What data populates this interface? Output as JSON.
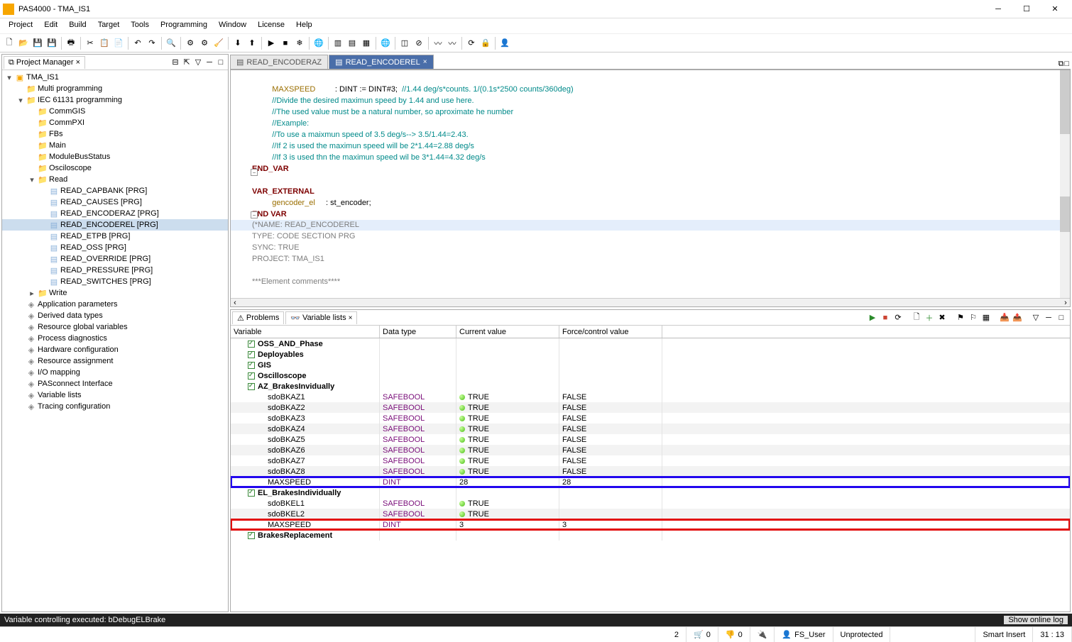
{
  "titlebar": {
    "title": "PAS4000 - TMA_IS1"
  },
  "menu": [
    "Project",
    "Edit",
    "Build",
    "Target",
    "Tools",
    "Programming",
    "Window",
    "License",
    "Help"
  ],
  "pm": {
    "title": "Project Manager",
    "tree": [
      {
        "lvl": 0,
        "exp": "-",
        "ic": "proj",
        "label": "TMA_IS1"
      },
      {
        "lvl": 1,
        "exp": " ",
        "ic": "folder",
        "label": "Multi programming"
      },
      {
        "lvl": 1,
        "exp": "-",
        "ic": "folder",
        "label": "IEC 61131 programming"
      },
      {
        "lvl": 2,
        "exp": " ",
        "ic": "folder",
        "label": "CommGIS"
      },
      {
        "lvl": 2,
        "exp": " ",
        "ic": "folder",
        "label": "CommPXI"
      },
      {
        "lvl": 2,
        "exp": " ",
        "ic": "folder",
        "label": "FBs"
      },
      {
        "lvl": 2,
        "exp": " ",
        "ic": "folder",
        "label": "Main"
      },
      {
        "lvl": 2,
        "exp": " ",
        "ic": "folder",
        "label": "ModuleBusStatus"
      },
      {
        "lvl": 2,
        "exp": " ",
        "ic": "folder",
        "label": "Osciloscope"
      },
      {
        "lvl": 2,
        "exp": "-",
        "ic": "folder",
        "label": "Read"
      },
      {
        "lvl": 3,
        "exp": " ",
        "ic": "prg",
        "label": "READ_CAPBANK [PRG]"
      },
      {
        "lvl": 3,
        "exp": " ",
        "ic": "prg",
        "label": "READ_CAUSES [PRG]"
      },
      {
        "lvl": 3,
        "exp": " ",
        "ic": "prg",
        "label": "READ_ENCODERAZ [PRG]"
      },
      {
        "lvl": 3,
        "exp": " ",
        "ic": "prg",
        "label": "READ_ENCODEREL [PRG]",
        "sel": true
      },
      {
        "lvl": 3,
        "exp": " ",
        "ic": "prg",
        "label": "READ_ETPB [PRG]"
      },
      {
        "lvl": 3,
        "exp": " ",
        "ic": "prg",
        "label": "READ_OSS [PRG]"
      },
      {
        "lvl": 3,
        "exp": " ",
        "ic": "prg",
        "label": "READ_OVERRIDE [PRG]"
      },
      {
        "lvl": 3,
        "exp": " ",
        "ic": "prg",
        "label": "READ_PRESSURE [PRG]"
      },
      {
        "lvl": 3,
        "exp": " ",
        "ic": "prg",
        "label": "READ_SWITCHES [PRG]"
      },
      {
        "lvl": 2,
        "exp": "+",
        "ic": "folder",
        "label": "Write"
      },
      {
        "lvl": 1,
        "exp": " ",
        "ic": "gear",
        "label": "Application parameters"
      },
      {
        "lvl": 1,
        "exp": " ",
        "ic": "gear",
        "label": "Derived data types"
      },
      {
        "lvl": 1,
        "exp": " ",
        "ic": "gear",
        "label": "Resource global variables"
      },
      {
        "lvl": 1,
        "exp": " ",
        "ic": "gear",
        "label": "Process diagnostics"
      },
      {
        "lvl": 1,
        "exp": " ",
        "ic": "gear",
        "label": "Hardware configuration"
      },
      {
        "lvl": 1,
        "exp": " ",
        "ic": "gear",
        "label": "Resource assignment"
      },
      {
        "lvl": 1,
        "exp": " ",
        "ic": "gear",
        "label": "I/O mapping"
      },
      {
        "lvl": 1,
        "exp": " ",
        "ic": "gear",
        "label": "PASconnect Interface"
      },
      {
        "lvl": 1,
        "exp": " ",
        "ic": "gear",
        "label": "Variable lists"
      },
      {
        "lvl": 1,
        "exp": " ",
        "ic": "gear",
        "label": "Tracing configuration"
      }
    ]
  },
  "editor_tabs": [
    {
      "label": "READ_ENCODERAZ",
      "active": false
    },
    {
      "label": "READ_ENCODEREL",
      "active": true
    }
  ],
  "code": {
    "l1a": "    MAXSPEED",
    "l1b": "         : DINT := DINT#3;  ",
    "l1c": "//1.44 deg/s*counts. 1/(0.1s*2500 counts/360deg)",
    "l2": "    //Divide the desired maximun speed by 1.44 and use here.",
    "l3": "    //The used value must be a natural number, so aproximate he number",
    "l4": "    //Example:",
    "l5": "    //To use a maixmun speed of 3.5 deg/s--> 3.5/1.44=2.43.",
    "l6": "    //If 2 is used the maximun speed will be 2*1.44=2.88 deg/s",
    "l7": "    //If 3 is used thn the maximun speed wil be 3*1.44=4.32 deg/s",
    "l8": "END_VAR",
    "l9": "",
    "l10": "VAR_EXTERNAL",
    "l11a": "    gencoder_el",
    "l11b": "     : st_encoder;",
    "l12": "END VAR",
    "l13": "",
    "l14": "(*NAME: READ_ENCODEREL",
    "l15": "TYPE: CODE SECTION PRG",
    "l16": "SYNC: TRUE",
    "l17": "PROJECT: TMA_IS1",
    "l18": "",
    "l19": "***Element comments****",
    "l20": "",
    "l21": "*)"
  },
  "varpanel": {
    "tabs": [
      {
        "label": "Problems",
        "active": false
      },
      {
        "label": "Variable lists",
        "active": true
      }
    ],
    "cols": [
      "Variable",
      "Data type",
      "Current value",
      "Force/control value"
    ],
    "rows": [
      {
        "group": true,
        "var": "OSS_AND_Phase"
      },
      {
        "group": true,
        "var": "Deployables"
      },
      {
        "group": true,
        "var": "GIS"
      },
      {
        "group": true,
        "var": "Oscilloscope"
      },
      {
        "group": true,
        "var": "AZ_BrakesInvidually"
      },
      {
        "var": "sdoBKAZ1",
        "type": "SAFEBOOL",
        "cur": "TRUE",
        "led": true,
        "force": "FALSE",
        "alt": false
      },
      {
        "var": "sdoBKAZ2",
        "type": "SAFEBOOL",
        "cur": "TRUE",
        "led": true,
        "force": "FALSE",
        "alt": true
      },
      {
        "var": "sdoBKAZ3",
        "type": "SAFEBOOL",
        "cur": "TRUE",
        "led": true,
        "force": "FALSE",
        "alt": false
      },
      {
        "var": "sdoBKAZ4",
        "type": "SAFEBOOL",
        "cur": "TRUE",
        "led": true,
        "force": "FALSE",
        "alt": true
      },
      {
        "var": "sdoBKAZ5",
        "type": "SAFEBOOL",
        "cur": "TRUE",
        "led": true,
        "force": "FALSE",
        "alt": false
      },
      {
        "var": "sdoBKAZ6",
        "type": "SAFEBOOL",
        "cur": "TRUE",
        "led": true,
        "force": "FALSE",
        "alt": true
      },
      {
        "var": "sdoBKAZ7",
        "type": "SAFEBOOL",
        "cur": "TRUE",
        "led": true,
        "force": "FALSE",
        "alt": false
      },
      {
        "var": "sdoBKAZ8",
        "type": "SAFEBOOL",
        "cur": "TRUE",
        "led": true,
        "force": "FALSE",
        "alt": true
      },
      {
        "var": "MAXSPEED",
        "type": "DINT",
        "cur": "28",
        "force": "28",
        "alt": false,
        "hl": "blue"
      },
      {
        "group": true,
        "var": "EL_BrakesIndividually"
      },
      {
        "var": "sdoBKEL1",
        "type": "SAFEBOOL",
        "cur": "TRUE",
        "led": true,
        "alt": false
      },
      {
        "var": "sdoBKEL2",
        "type": "SAFEBOOL",
        "cur": "TRUE",
        "led": true,
        "alt": true
      },
      {
        "var": "MAXSPEED",
        "type": "DINT",
        "cur": "3",
        "force": "3",
        "alt": false,
        "hl": "red"
      },
      {
        "group": true,
        "var": "BrakesReplacement"
      }
    ]
  },
  "status1": {
    "msg": "Variable controlling executed: bDebugELBrake",
    "btn": "Show online log"
  },
  "status2": {
    "cnt1": "2",
    "cnt2": "0",
    "cnt3": "0",
    "user": "FS_User",
    "prot": "Unprotected",
    "ins": "Smart Insert",
    "pos": "31 : 13"
  }
}
